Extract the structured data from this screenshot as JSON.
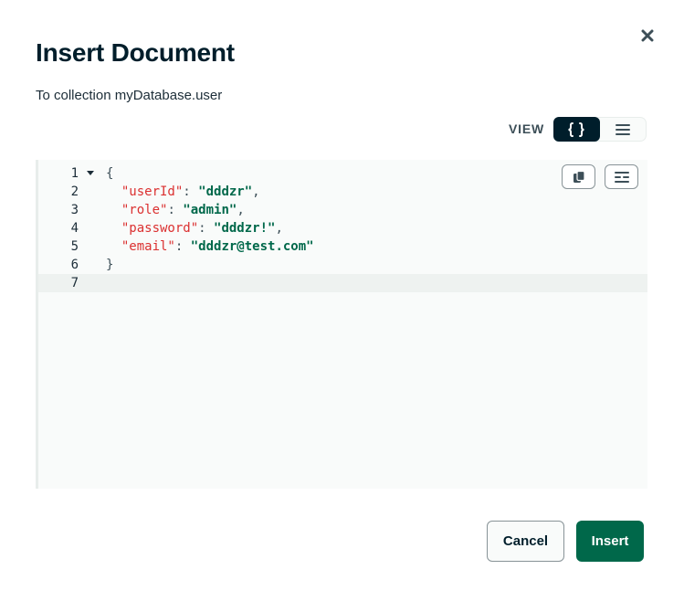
{
  "modal": {
    "title": "Insert Document",
    "subtitle": "To collection myDatabase.user",
    "close_icon": "close-icon"
  },
  "view_toggle": {
    "label": "VIEW",
    "options": [
      {
        "name": "json-view",
        "icon": "curly-braces-icon",
        "active": true
      },
      {
        "name": "list-view",
        "icon": "menu-lines-icon",
        "active": false
      }
    ]
  },
  "editor": {
    "toolbar": [
      {
        "name": "copy-button",
        "icon": "copy-icon"
      },
      {
        "name": "format-button",
        "icon": "format-icon"
      }
    ],
    "lines": [
      {
        "num": "1",
        "text": "{"
      },
      {
        "num": "2",
        "key": "\"userId\"",
        "value": "\"dddzr\""
      },
      {
        "num": "3",
        "key": "\"role\"",
        "value": "\"admin\""
      },
      {
        "num": "4",
        "key": "\"password\"",
        "value": "\"dddzr!\""
      },
      {
        "num": "5",
        "key": "\"email\"",
        "value": "\"dddzr@test.com\""
      },
      {
        "num": "6",
        "text": "}"
      },
      {
        "num": "7",
        "text": ""
      }
    ],
    "active_line": 7
  },
  "footer": {
    "cancel_label": "Cancel",
    "insert_label": "Insert"
  },
  "colors": {
    "primary": "#00684a",
    "dark": "#001e2b",
    "key": "#db3030",
    "string": "#00684a"
  }
}
